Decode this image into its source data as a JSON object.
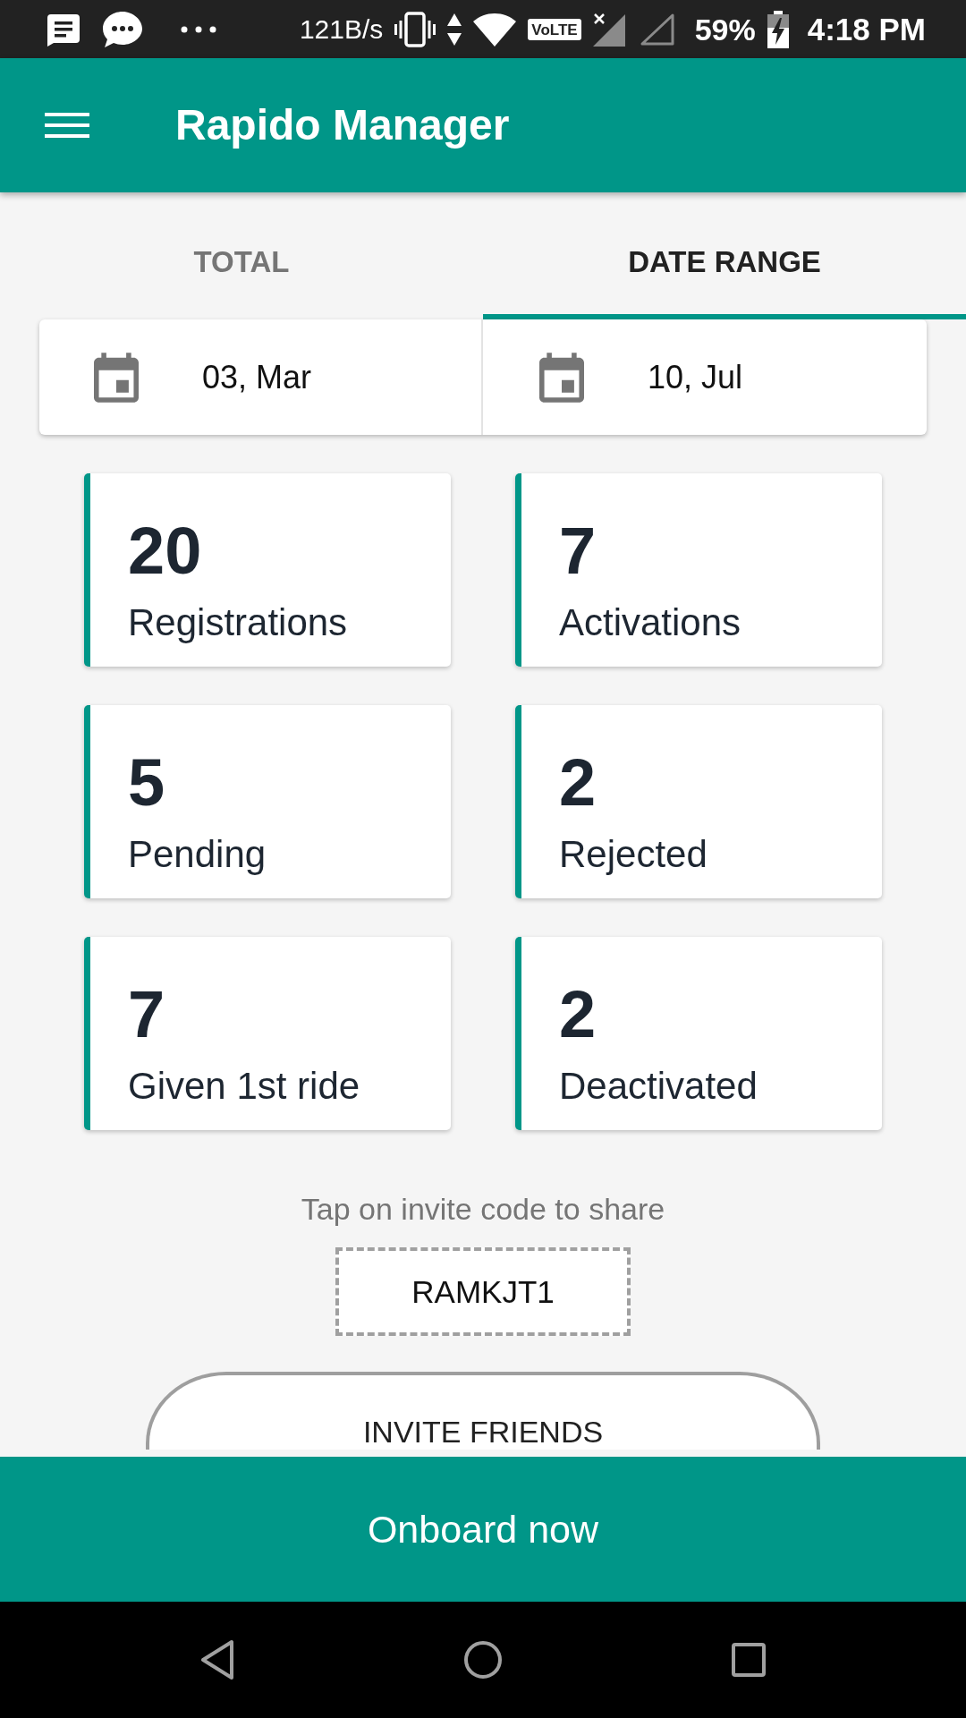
{
  "status_bar": {
    "network_speed": "121B/s",
    "volte": "VoLTE",
    "battery": "59%",
    "time": "4:18 PM"
  },
  "app_bar": {
    "title": "Rapido Manager"
  },
  "tabs": [
    {
      "label": "TOTAL",
      "selected": false
    },
    {
      "label": "DATE RANGE",
      "selected": true
    }
  ],
  "date_range": {
    "from": "03, Mar",
    "to": "10, Jul"
  },
  "stats": [
    {
      "value": "20",
      "label": "Registrations"
    },
    {
      "value": "7",
      "label": "Activations"
    },
    {
      "value": "5",
      "label": "Pending"
    },
    {
      "value": "2",
      "label": "Rejected"
    },
    {
      "value": "7",
      "label": "Given 1st ride"
    },
    {
      "value": "2",
      "label": "Deactivated"
    }
  ],
  "invite": {
    "hint": "Tap on invite code to share",
    "code": "RAMKJT1",
    "button": "INVITE FRIENDS"
  },
  "onboard_button": {
    "label": "Onboard now"
  }
}
